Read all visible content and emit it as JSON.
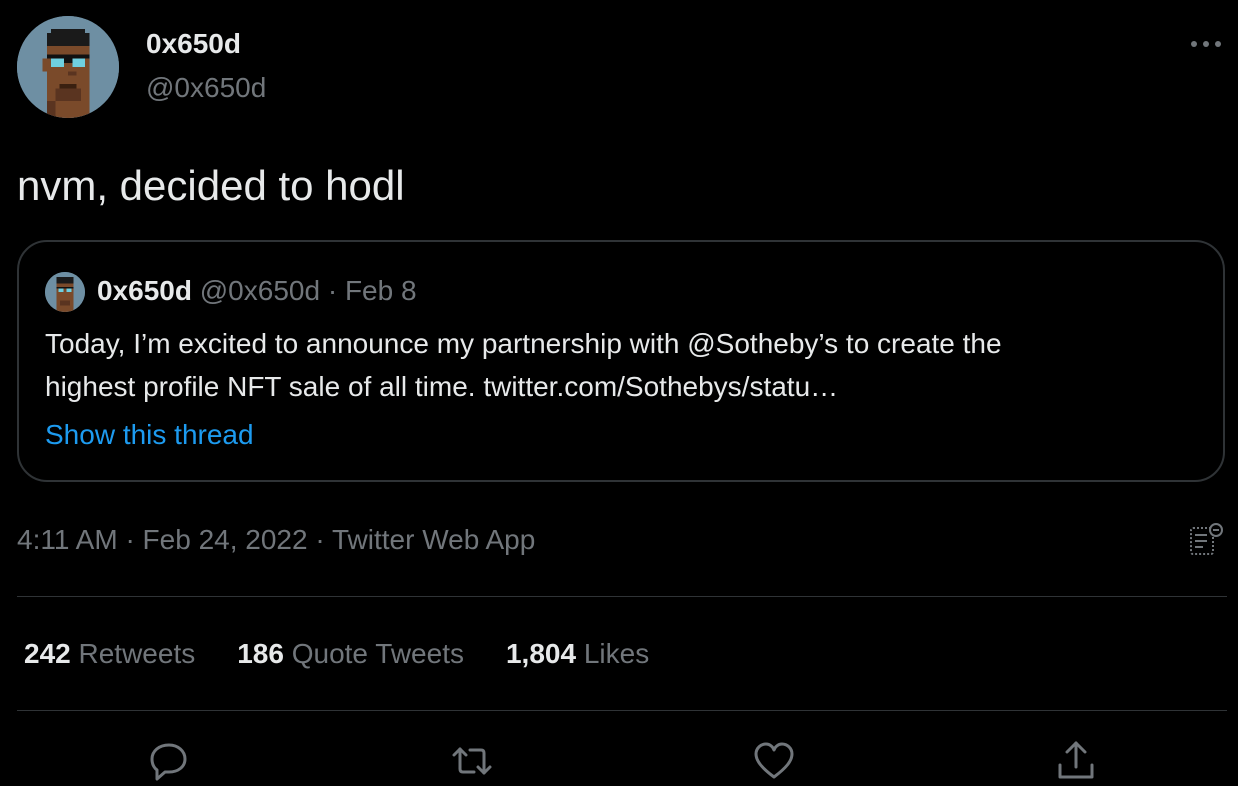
{
  "author": {
    "display_name": "0x650d",
    "handle": "@0x650d",
    "avatar_icon": "pixel-punk-avatar"
  },
  "tweet": {
    "text": "nvm, decided to hodl"
  },
  "quoted_tweet": {
    "display_name": "0x650d",
    "handle": "@0x650d",
    "separator": "·",
    "date": "Feb 8",
    "text_line_1": "Today, I’m excited to announce my partnership with @Sotheby’s to create the",
    "text_line_2": "highest profile NFT sale of all time. twitter.com/Sothebys/statu…",
    "show_thread_label": "Show this thread"
  },
  "meta": {
    "time": "4:11 AM",
    "separator": "·",
    "date": "Feb 24, 2022",
    "source": "Twitter Web App"
  },
  "stats": {
    "retweets_count": "242",
    "retweets_label": "Retweets",
    "quotes_count": "186",
    "quotes_label": "Quote Tweets",
    "likes_count": "1,804",
    "likes_label": "Likes"
  },
  "actions": {
    "reply_icon": "reply-icon",
    "retweet_icon": "retweet-icon",
    "like_icon": "heart-icon",
    "share_icon": "share-icon"
  },
  "colors": {
    "background": "#000000",
    "text_primary": "#e7e9ea",
    "text_secondary": "#71767b",
    "link": "#1d9bf0",
    "border": "#2f3336"
  }
}
